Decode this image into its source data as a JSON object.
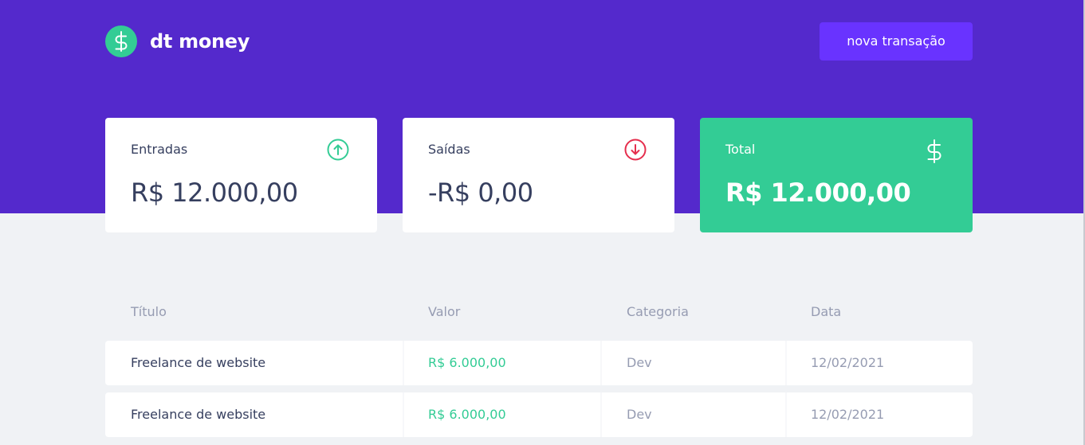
{
  "app": {
    "name": "dt money",
    "new_transaction_label": "nova transação"
  },
  "summary": {
    "income": {
      "label": "Entradas",
      "value": "R$ 12.000,00",
      "icon": "arrow-up-circle-icon",
      "color": "#33cc95"
    },
    "outcome": {
      "label": "Saídas",
      "value": "-R$ 0,00",
      "icon": "arrow-down-circle-icon",
      "color": "#e52e4d"
    },
    "total": {
      "label": "Total",
      "value": "R$ 12.000,00",
      "icon": "dollar-icon",
      "color": "#33cc95"
    }
  },
  "table": {
    "headers": [
      "Título",
      "Valor",
      "Categoria",
      "Data"
    ],
    "rows": [
      {
        "title": "Freelance de website",
        "amount": "R$ 6.000,00",
        "category": "Dev",
        "date": "12/02/2021"
      },
      {
        "title": "Freelance de website",
        "amount": "R$ 6.000,00",
        "category": "Dev",
        "date": "12/02/2021"
      }
    ]
  },
  "colors": {
    "header_bg": "#5429cc",
    "button_bg": "#6933ff",
    "green": "#33cc95",
    "red": "#e52e4d",
    "text_title": "#363f5f",
    "text_body": "#969cb2",
    "background": "#f0f2f5"
  }
}
